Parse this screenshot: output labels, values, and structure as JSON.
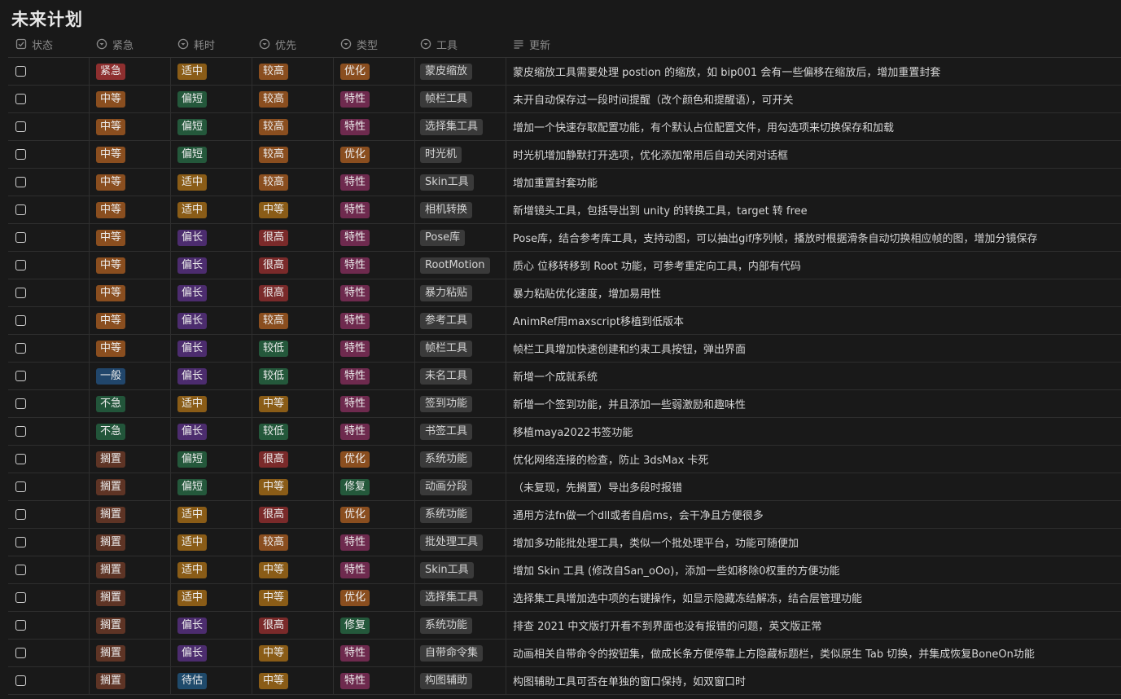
{
  "page": {
    "title": "未来计划"
  },
  "headers": {
    "status": "状态",
    "urgency": "紧急",
    "duration": "耗时",
    "priority": "优先",
    "type": "类型",
    "tool": "工具",
    "update": "更新"
  },
  "colors": {
    "紧急": "#8e2f2f",
    "中等": "#8a4e1f",
    "一般": "#21466b",
    "不急": "#22553a",
    "搁置": "#5e3425",
    "适中": "#8a5c17",
    "偏短": "#24583b",
    "偏长": "#4c2c6e",
    "待估": "#1f4a6b",
    "较高": "#8a4e1f",
    "中等P": "#8a5c17",
    "很高": "#7a2a2a",
    "较低": "#24583b",
    "优化": "#8a4e1f",
    "特性": "#6e2a4e",
    "修复": "#24583b"
  },
  "rows": [
    {
      "checked": false,
      "urgency": "紧急",
      "duration": "适中",
      "priority": "较高",
      "type": "优化",
      "tool": "蒙皮缩放",
      "update": "蒙皮缩放工具需要处理 postion 的缩放，如 bip001 会有一些偏移在缩放后，增加重置封套"
    },
    {
      "checked": false,
      "urgency": "中等",
      "duration": "偏短",
      "priority": "较高",
      "type": "特性",
      "tool": "帧栏工具",
      "update": "未开自动保存过一段时间提醒（改个颜色和提醒语），可开关"
    },
    {
      "checked": false,
      "urgency": "中等",
      "duration": "偏短",
      "priority": "较高",
      "type": "特性",
      "tool": "选择集工具",
      "update": "增加一个快速存取配置功能，有个默认占位配置文件，用勾选项来切换保存和加载"
    },
    {
      "checked": false,
      "urgency": "中等",
      "duration": "偏短",
      "priority": "较高",
      "type": "优化",
      "tool": "时光机",
      "update": "时光机增加静默打开选项，优化添加常用后自动关闭对话框"
    },
    {
      "checked": false,
      "urgency": "中等",
      "duration": "适中",
      "priority": "较高",
      "type": "特性",
      "tool": "Skin工具",
      "update": "增加重置封套功能"
    },
    {
      "checked": false,
      "urgency": "中等",
      "duration": "适中",
      "priority": "中等",
      "type": "特性",
      "tool": "相机转换",
      "update": "新增镜头工具，包括导出到 unity 的转换工具，target 转 free"
    },
    {
      "checked": false,
      "urgency": "中等",
      "duration": "偏长",
      "priority": "很高",
      "type": "特性",
      "tool": "Pose库",
      "update": "Pose库，结合参考库工具，支持动图，可以抽出gif序列帧，播放时根据滑条自动切换相应帧的图，增加分镜保存"
    },
    {
      "checked": false,
      "urgency": "中等",
      "duration": "偏长",
      "priority": "很高",
      "type": "特性",
      "tool": "RootMotion",
      "update": "质心 位移转移到 Root 功能，可参考重定向工具，内部有代码"
    },
    {
      "checked": false,
      "urgency": "中等",
      "duration": "偏长",
      "priority": "很高",
      "type": "特性",
      "tool": "暴力粘贴",
      "update": "暴力粘贴优化速度，增加易用性"
    },
    {
      "checked": false,
      "urgency": "中等",
      "duration": "偏长",
      "priority": "较高",
      "type": "特性",
      "tool": "参考工具",
      "update": "AnimRef用maxscript移植到低版本"
    },
    {
      "checked": false,
      "urgency": "中等",
      "duration": "偏长",
      "priority": "较低",
      "type": "特性",
      "tool": "帧栏工具",
      "update": "帧栏工具增加快速创建和约束工具按钮，弹出界面"
    },
    {
      "checked": false,
      "urgency": "一般",
      "duration": "偏长",
      "priority": "较低",
      "type": "特性",
      "tool": "未名工具",
      "update": "新增一个成就系统"
    },
    {
      "checked": false,
      "urgency": "不急",
      "duration": "适中",
      "priority": "中等",
      "type": "特性",
      "tool": "签到功能",
      "update": "新增一个签到功能，并且添加一些弱激励和趣味性"
    },
    {
      "checked": false,
      "urgency": "不急",
      "duration": "偏长",
      "priority": "较低",
      "type": "特性",
      "tool": "书签工具",
      "update": "移植maya2022书签功能"
    },
    {
      "checked": false,
      "urgency": "搁置",
      "duration": "偏短",
      "priority": "很高",
      "type": "优化",
      "tool": "系统功能",
      "update": "优化网络连接的检查，防止 3dsMax 卡死"
    },
    {
      "checked": false,
      "urgency": "搁置",
      "duration": "偏短",
      "priority": "中等",
      "type": "修复",
      "tool": "动画分段",
      "update": "（未复现，先搁置）导出多段时报错"
    },
    {
      "checked": false,
      "urgency": "搁置",
      "duration": "适中",
      "priority": "很高",
      "type": "优化",
      "tool": "系统功能",
      "update": "通用方法fn做一个dll或者自启ms，会干净且方便很多"
    },
    {
      "checked": false,
      "urgency": "搁置",
      "duration": "适中",
      "priority": "较高",
      "type": "特性",
      "tool": "批处理工具",
      "update": "增加多功能批处理工具，类似一个批处理平台，功能可随便加"
    },
    {
      "checked": false,
      "urgency": "搁置",
      "duration": "适中",
      "priority": "中等",
      "type": "特性",
      "tool": "Skin工具",
      "update": "增加 Skin 工具 (修改自San_oOo)，添加一些如移除0权重的方便功能"
    },
    {
      "checked": false,
      "urgency": "搁置",
      "duration": "适中",
      "priority": "中等",
      "type": "优化",
      "tool": "选择集工具",
      "update": "选择集工具增加选中项的右键操作，如显示隐藏冻结解冻，结合层管理功能"
    },
    {
      "checked": false,
      "urgency": "搁置",
      "duration": "偏长",
      "priority": "很高",
      "type": "修复",
      "tool": "系统功能",
      "update": "排查 2021 中文版打开看不到界面也没有报错的问题，英文版正常"
    },
    {
      "checked": false,
      "urgency": "搁置",
      "duration": "偏长",
      "priority": "中等",
      "type": "特性",
      "tool": "自带命令集",
      "update": "动画相关自带命令的按钮集，做成长条方便停靠上方隐藏标题栏，类似原生 Tab 切换，并集成恢复BoneOn功能"
    },
    {
      "checked": false,
      "urgency": "搁置",
      "duration": "待估",
      "priority": "中等",
      "type": "特性",
      "tool": "构图辅助",
      "update": "构图辅助工具可否在单独的窗口保持，如双窗口时"
    }
  ]
}
